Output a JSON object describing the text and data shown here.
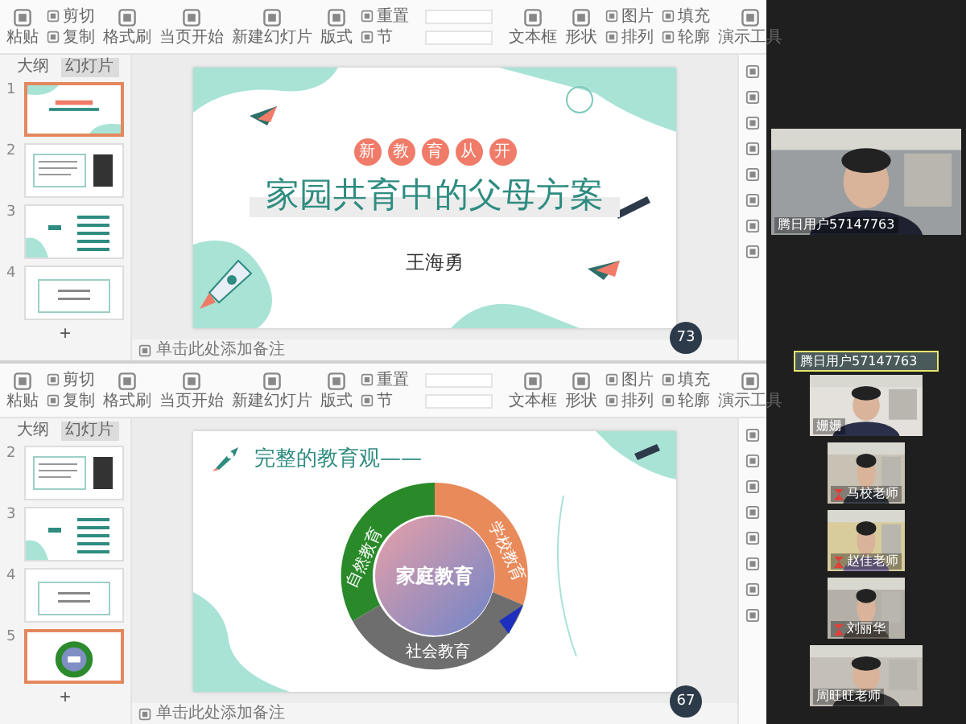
{
  "windows": [
    {
      "toolbar": {
        "large_left": [
          "粘贴",
          "格式刷",
          "当页开始",
          "新建幻灯片",
          "版式"
        ],
        "small_left": [
          "剪切",
          "复制"
        ],
        "small_mid": [
          "重置",
          "节"
        ],
        "large_right": [
          "文本框",
          "形状"
        ],
        "small_right": [
          "图片",
          "排列",
          "填充",
          "轮廓"
        ],
        "tools": "演示工具"
      },
      "panel_tabs": [
        {
          "label": "大纲",
          "selected": false
        },
        {
          "label": "幻灯片",
          "selected": true
        }
      ],
      "thumbnails": [
        {
          "number": "1",
          "selected": true,
          "kind": "cover"
        },
        {
          "number": "2",
          "selected": false,
          "kind": "profile"
        },
        {
          "number": "3",
          "selected": false,
          "kind": "contents"
        },
        {
          "number": "4",
          "selected": false,
          "kind": "questions"
        }
      ],
      "add_label": "+",
      "slide": {
        "kind": "cover",
        "badges": [
          "新",
          "教",
          "育",
          "从",
          "开"
        ],
        "title": "家园共育中的父母方案",
        "author": "王海勇"
      },
      "notes_placeholder": "单击此处添加备注",
      "zoom": "73"
    },
    {
      "toolbar": {
        "large_left": [
          "粘贴",
          "格式刷",
          "当页开始",
          "新建幻灯片",
          "版式"
        ],
        "small_left": [
          "剪切",
          "复制"
        ],
        "small_mid": [
          "重置",
          "节"
        ],
        "large_right": [
          "文本框",
          "形状"
        ],
        "small_right": [
          "图片",
          "排列",
          "填充",
          "轮廓"
        ],
        "tools": "演示工具"
      },
      "panel_tabs": [
        {
          "label": "大纲",
          "selected": false
        },
        {
          "label": "幻灯片",
          "selected": true
        }
      ],
      "thumbnails": [
        {
          "number": "2",
          "selected": false,
          "kind": "profile"
        },
        {
          "number": "3",
          "selected": false,
          "kind": "contents"
        },
        {
          "number": "4",
          "selected": false,
          "kind": "questions"
        },
        {
          "number": "5",
          "selected": true,
          "kind": "ring"
        }
      ],
      "add_label": "+",
      "slide": {
        "kind": "ring",
        "title": "完整的教育观——",
        "center": "家庭教育",
        "segments": [
          "自然教育",
          "学校教育",
          "社会教育"
        ]
      },
      "notes_placeholder": "单击此处添加备注",
      "zoom": "67"
    }
  ],
  "main_video": {
    "name": "腾日用户57147763"
  },
  "active_speaker": {
    "name": "腾日用户57147763",
    "selected": true
  },
  "participants": [
    {
      "name": "姗姗",
      "kind": "wide"
    },
    {
      "name": "马校老师",
      "kind": "narrow"
    },
    {
      "name": "赵佳老师",
      "kind": "narrow"
    },
    {
      "name": "刘丽华",
      "kind": "narrow"
    },
    {
      "name": "周旺旺老师",
      "kind": "wide"
    }
  ]
}
